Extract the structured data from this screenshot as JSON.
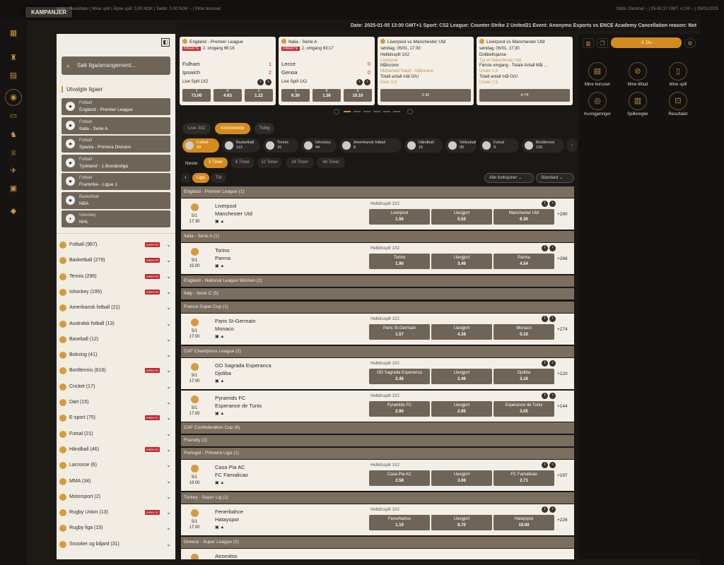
{
  "topbar": {
    "kampanjer": "KAMPANJER",
    "links": "ggler  |  Resultater  |  Mine spill  |  Åpne spill: 0,00 NOK  |  Saldo: 0,00 NOK  ~  |  Mine bonuser",
    "right": "Odds: Desimal  ~  |  05:45:37 GMT +1:00  ~  |  05/01/2025"
  },
  "ticker": "Date: 2025-01-05 13:00 GMT+1 Sport: CS2 League: Counter-Strike 2 United21 Event: Anonymo Esports vs ENCE Academy Cancellation reason: Not",
  "sidebar": {
    "search_placeholder": "Søk liga/arrangement...",
    "featured_title": "Utvalgte ligaer",
    "featured": [
      {
        "sport": "Fotball",
        "league": "England - Premier League"
      },
      {
        "sport": "Fotball",
        "league": "Italia - Serie A"
      },
      {
        "sport": "Fotball",
        "league": "Spania - Primera Division"
      },
      {
        "sport": "Fotball",
        "league": "Tyskland - 1.Bundesliga"
      },
      {
        "sport": "Fotball",
        "league": "Frankrike - Ligue 1"
      },
      {
        "sport": "Basketball",
        "league": "NBA"
      },
      {
        "sport": "Ishockey",
        "league": "NHL"
      }
    ],
    "direkte": "DIREKTE",
    "sports": [
      {
        "label": "Fotball  (987)",
        "live": true
      },
      {
        "label": "Basketball  (279)",
        "live": true
      },
      {
        "label": "Tennis  (296)",
        "live": true
      },
      {
        "label": "Ishockey  (195)",
        "live": true
      },
      {
        "label": "Amerikansk fotball  (21)",
        "live": false
      },
      {
        "label": "Australsk fotball  (13)",
        "live": false
      },
      {
        "label": "Baseball  (12)",
        "live": false
      },
      {
        "label": "Boksing  (41)",
        "live": false
      },
      {
        "label": "Bordtennis  (616)",
        "live": true
      },
      {
        "label": "Cricket  (17)",
        "live": false
      },
      {
        "label": "Dart  (15)",
        "live": false
      },
      {
        "label": "E-sport  (75)",
        "live": true
      },
      {
        "label": "Futsal  (21)",
        "live": false
      },
      {
        "label": "Håndball  (46)",
        "live": true
      },
      {
        "label": "Lacrosse  (6)",
        "live": false
      },
      {
        "label": "MMA  (34)",
        "live": false
      },
      {
        "label": "Motorsport  (2)",
        "live": false
      },
      {
        "label": "Rugby Union  (13)",
        "live": true
      },
      {
        "label": "Rugby liga  (15)",
        "live": false
      },
      {
        "label": "Snooker og biljard  (31)",
        "live": false
      }
    ]
  },
  "cards": [
    {
      "header": "England - Premier League",
      "info": "2. omgang 66:16",
      "home": "Fulham",
      "away": "Ipswich",
      "hs": "1",
      "as": "2",
      "market": "Live Spill 1X2",
      "odds": [
        {
          "l": "1",
          "v": "73.00"
        },
        {
          "l": "X",
          "v": "4.63"
        },
        {
          "l": "2",
          "v": "1.22"
        }
      ]
    },
    {
      "header": "Italia - Serie A",
      "info": "2. omgang 63:17",
      "home": "Lecce",
      "away": "Genoa",
      "hs": "0",
      "as": "0",
      "market": "Live Spill 1X2",
      "odds": [
        {
          "l": "1",
          "v": "6.30"
        },
        {
          "l": "X",
          "v": "1.36"
        },
        {
          "l": "2",
          "v": "10.10"
        }
      ]
    },
    {
      "header": "Liverpool vs Manchester Utd",
      "date": "søndag, 05/01, 17:30",
      "lines": [
        "Heltidsspill 1X2",
        "Liverpool",
        "Målscorer",
        "Mohamed Salah - Målscorer",
        "Totalt antall mål O/U",
        "Over 2.5"
      ],
      "odd": "2.42"
    },
    {
      "header": "Liverpool vs Manchester Utd",
      "date": "søndag, 05/01, 17:30",
      "lines": [
        "Dobbeltsjanse",
        "Tja or Manchester Utd",
        "Første omgang - Totale Antall Mål ...",
        "Under 1.5",
        "Totalt antall mål O/U",
        "Under 2.5"
      ],
      "odd": "4.74"
    }
  ],
  "tabs": {
    "live": "Live  332",
    "upcoming": "Kommende",
    "later": "Tidlig"
  },
  "sportbar": [
    {
      "n": "Fotball",
      "c": "94"
    },
    {
      "n": "Basketball",
      "c": "113"
    },
    {
      "n": "Tennis",
      "c": "16"
    },
    {
      "n": "Ishockey",
      "c": "44"
    },
    {
      "n": "Amerikansk fotball",
      "c": "8"
    },
    {
      "n": "Håndball",
      "c": "15"
    },
    {
      "n": "Volleyball",
      "c": "30"
    },
    {
      "n": "Futsal",
      "c": "9"
    },
    {
      "n": "Bordtennis",
      "c": "136"
    }
  ],
  "time": {
    "label": "Neste:",
    "options": [
      "3 Timer",
      "6 Timer",
      "12 Timer",
      "24 Timer",
      "48 Timer"
    ]
  },
  "sort": {
    "liga": "Liga",
    "tid": "Tid",
    "funksjoner": "Alle funksjoner  ⌄",
    "standard": "Standard  ⌄"
  },
  "leagues": [
    "England - Premier League (1)",
    "Italia - Serie A (1)",
    "England - National League Women (2)",
    "Italy - Serie C (5)",
    "France Super Cup (1)",
    "CAF Champions League (2)",
    "CAF Confederation Cup (6)",
    "Friendly (2)",
    "Portugal - Primeira Liga (1)",
    "Turkey - Super Lig (1)",
    "Greece - Super League (2)"
  ],
  "events": [
    {
      "date": "5/1",
      "time": "17:30",
      "home": "Liverpool",
      "away": "Manchester Utd",
      "market": "Heltidsspill 1X2",
      "o": [
        {
          "n": "Liverpool",
          "v": "1.56"
        },
        {
          "n": "Uavgjort",
          "v": "5.50"
        },
        {
          "n": "Manchester Utd",
          "v": "6.30"
        }
      ],
      "more": "+290"
    },
    {
      "date": "5/1",
      "time": "15:00",
      "home": "Torino",
      "away": "Parma",
      "market": "Heltidsspill 1X2",
      "o": [
        {
          "n": "Torino",
          "v": "1.90"
        },
        {
          "n": "Uavgjort",
          "v": "3.46"
        },
        {
          "n": "Parma",
          "v": "4.54"
        }
      ],
      "more": "+266"
    },
    {
      "date": "5/1",
      "time": "17:00",
      "home": "Paris St-Germain",
      "away": "Monaco",
      "market": "Heltidsspill 1X2",
      "o": [
        {
          "n": "Paris St-Germain",
          "v": "1.57"
        },
        {
          "n": "Uavgjort",
          "v": "4.38"
        },
        {
          "n": "Monaco",
          "v": "5.10"
        }
      ],
      "more": "+274"
    },
    {
      "date": "5/1",
      "time": "17:00",
      "home": "GD Sagrada Esperanca",
      "away": "Djoliba",
      "market": "Heltidsspill 1X2",
      "o": [
        {
          "n": "GD Sagrada Esperanca",
          "v": "2.48"
        },
        {
          "n": "Uavgjort",
          "v": "2.46"
        },
        {
          "n": "Djoliba",
          "v": "3.16"
        }
      ],
      "more": "+120"
    },
    {
      "date": "5/1",
      "time": "17:00",
      "home": "Pyramids FC",
      "away": "Esperance de Tunis",
      "market": "Heltidsspill 1X2",
      "o": [
        {
          "n": "Pyramids FC",
          "v": "2.90"
        },
        {
          "n": "Uavgjort",
          "v": "2.95"
        },
        {
          "n": "Esperance de Tunis",
          "v": "3.05"
        }
      ],
      "more": "+144"
    },
    {
      "date": "5/1",
      "time": "19:00",
      "home": "Casa Pia AC",
      "away": "FC Famalicao",
      "market": "Heltidsspill 1X2",
      "o": [
        {
          "n": "Casa Pia AC",
          "v": "2.58"
        },
        {
          "n": "Uavgjort",
          "v": "3.06"
        },
        {
          "n": "FC Famalicao",
          "v": "2.71"
        }
      ],
      "more": "+197"
    },
    {
      "date": "5/1",
      "time": "17:00",
      "home": "Fenerbahce",
      "away": "Hatayspor",
      "market": "Heltidsspill 1X2",
      "o": [
        {
          "n": "Fenerbahce",
          "v": "1.10"
        },
        {
          "n": "Uavgjort",
          "v": "8.70"
        },
        {
          "n": "Hatayspor",
          "v": "19.00"
        }
      ],
      "more": "+226"
    },
    {
      "home": "Atromitos"
    }
  ],
  "right": {
    "du": "Du",
    "items": [
      "Mine bonuser",
      "Mine tilbud",
      "Mine spill",
      "Kunngjøringer",
      "Spilleregler",
      "Resultater"
    ]
  }
}
